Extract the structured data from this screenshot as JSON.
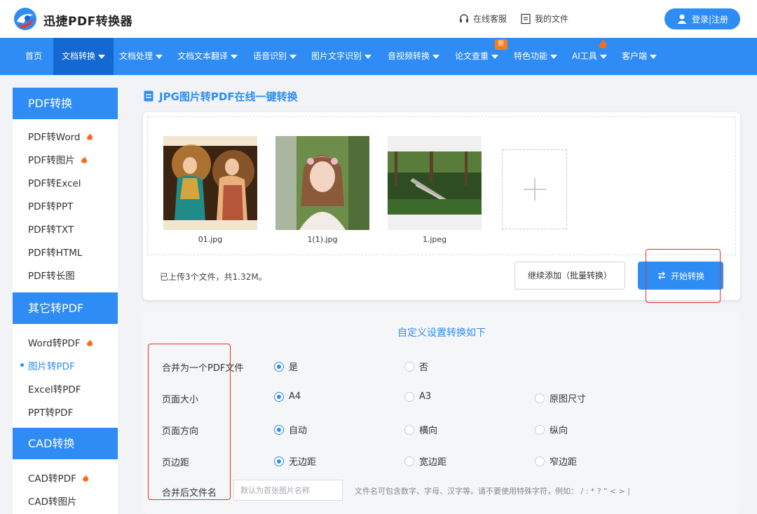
{
  "header": {
    "brand": "迅捷PDF转换器",
    "service": "在线客服",
    "my_files": "我的文件",
    "login": "登录|注册"
  },
  "nav": {
    "items": [
      {
        "label": "首页"
      },
      {
        "label": "文档转换"
      },
      {
        "label": "文档处理"
      },
      {
        "label": "文档文本翻译"
      },
      {
        "label": "语音识别"
      },
      {
        "label": "图片文字识别"
      },
      {
        "label": "音视频转换"
      },
      {
        "label": "论文查重"
      },
      {
        "label": "特色功能"
      },
      {
        "label": "AI工具"
      },
      {
        "label": "客户端"
      }
    ],
    "new_badge": "新"
  },
  "sidebar": {
    "groups": [
      {
        "title": "PDF转换",
        "items": [
          "PDF转Word",
          "PDF转图片",
          "PDF转Excel",
          "PDF转PPT",
          "PDF转TXT",
          "PDF转HTML",
          "PDF转长图"
        ]
      },
      {
        "title": "其它转PDF",
        "items": [
          "Word转PDF",
          "图片转PDF",
          "Excel转PDF",
          "PPT转PDF"
        ]
      },
      {
        "title": "CAD转换",
        "items": [
          "CAD转PDF",
          "CAD转图片"
        ]
      }
    ]
  },
  "main": {
    "title": "JPG图片转PDF在线一键转换",
    "files": [
      {
        "name": "01.jpg"
      },
      {
        "name": "1(1).jpg"
      },
      {
        "name": "1.jpeg"
      }
    ],
    "status": "已上传3个文件，共1.32M。",
    "add_more": "继续添加（批量转换）",
    "start": "开始转换"
  },
  "settings": {
    "title": "自定义设置转换如下",
    "rows": [
      {
        "label": "合并为一个PDF文件",
        "options": [
          "是",
          "否"
        ]
      },
      {
        "label": "页面大小",
        "options": [
          "A4",
          "A3",
          "原图尺寸"
        ]
      },
      {
        "label": "页面方向",
        "options": [
          "自动",
          "横向",
          "纵向"
        ]
      },
      {
        "label": "页边距",
        "options": [
          "无边距",
          "宽边距",
          "窄边距"
        ]
      }
    ],
    "filename_label": "合并后文件名",
    "filename_placeholder": "默认为首张图片名称",
    "filename_value": "",
    "hint": "文件名可包含数字、字母、汉字等。请不要使用特殊字符，例如： / : * ? \" < > |"
  },
  "colors": {
    "accent": "#2f8cf4",
    "accent_dark": "#1468d2",
    "highlight": "#e0342c",
    "flame": "#ff6a1a"
  }
}
